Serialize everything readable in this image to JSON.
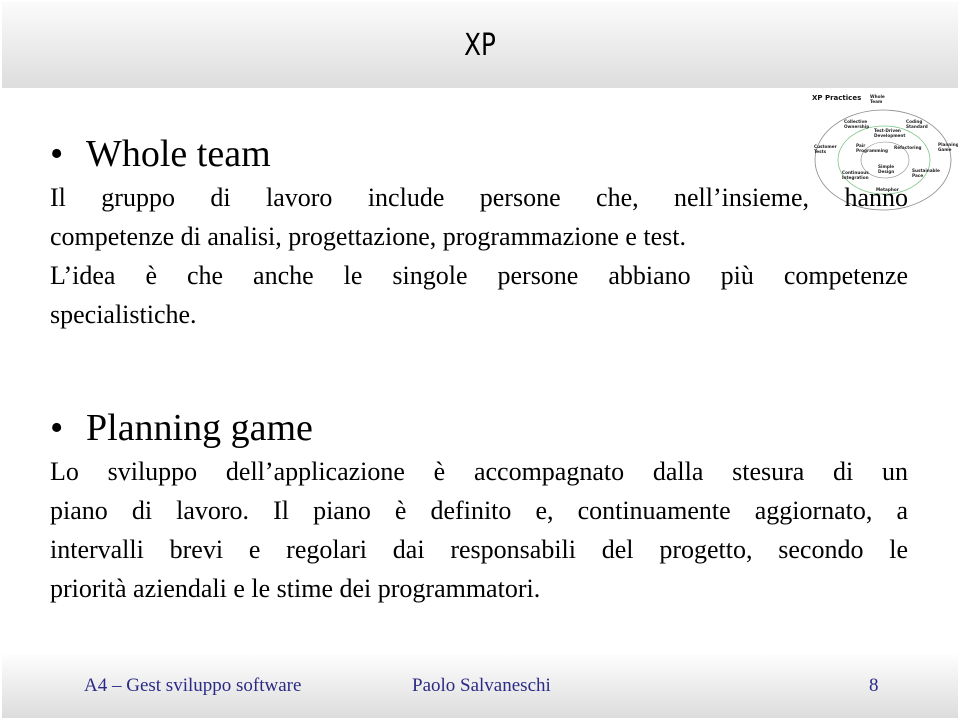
{
  "slide": {
    "title": "XP",
    "sections": [
      {
        "heading": "Whole team",
        "lines": [
          "Il gruppo di lavoro include persone che, nell’insieme, hanno",
          "competenze di analisi, progettazione, programmazione e test.",
          "L’idea è che anche le singole persone abbiano più competenze",
          "specialistiche."
        ]
      },
      {
        "heading": "Planning game",
        "lines": [
          "Lo sviluppo dell’applicazione è accompagnato dalla stesura di un",
          "piano di lavoro. Il piano è definito e, continuamente aggiornato, a",
          "intervalli brevi e regolari dai responsabili del progetto, secondo le",
          "priorità aziendali e le stime dei programmatori."
        ]
      }
    ],
    "bullet_glyph": "•"
  },
  "diagram": {
    "title": "XP Practices",
    "labels": {
      "whole_team": [
        "Whole",
        "Team"
      ],
      "collective_ownership": [
        "Collective",
        "Ownership"
      ],
      "coding_standard": [
        "Coding",
        "Standard"
      ],
      "test_driven": [
        "Test-Driven",
        "Development"
      ],
      "customer_tests": [
        "Customer",
        "Tests"
      ],
      "pair_programming": [
        "Pair",
        "Programming"
      ],
      "refactoring": [
        "Refactoring"
      ],
      "planning_game": [
        "Planning",
        "Game"
      ],
      "continuous_integration": [
        "Continuous",
        "Integration"
      ],
      "simple_design": [
        "Simple",
        "Design"
      ],
      "sustainable_pace": [
        "Sustainable",
        "Pace"
      ],
      "metaphor": [
        "Metaphor"
      ]
    }
  },
  "footer": {
    "course": "A4 – Gest sviluppo software",
    "author": "Paolo Salvaneschi",
    "page": "8"
  },
  "colors": {
    "footer_text": "#2b2b86",
    "diagram_outer_ring": "#8a8a8a",
    "diagram_middle_ring": "#7fc48a"
  }
}
